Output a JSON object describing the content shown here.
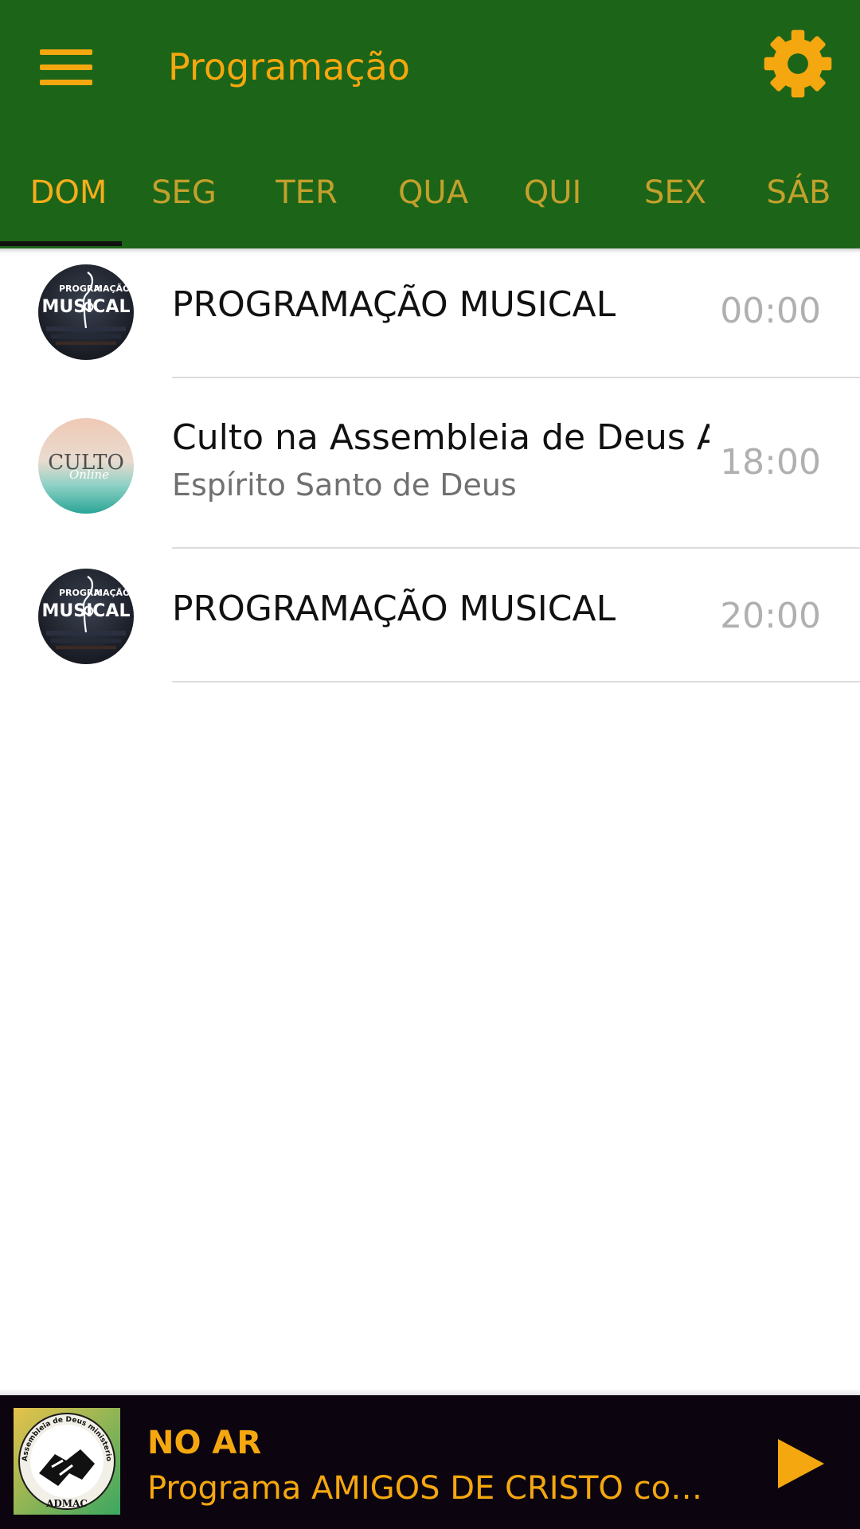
{
  "app": {
    "title": "Programação",
    "menu_icon": "hamburger-menu-icon",
    "settings_icon": "gear-icon",
    "colors": {
      "appbar": "#1c6418",
      "accent": "#f5a70f",
      "tab_inactive": "#c3a02c",
      "player_bg": "#0c0510"
    }
  },
  "tabs": [
    {
      "label": "DOM",
      "active": true
    },
    {
      "label": "SEG",
      "active": false
    },
    {
      "label": "TER",
      "active": false
    },
    {
      "label": "QUA",
      "active": false
    },
    {
      "label": "QUI",
      "active": false
    },
    {
      "label": "SEX",
      "active": false
    },
    {
      "label": "SÁB",
      "active": false
    }
  ],
  "schedule": [
    {
      "title": "PROGRAMAÇÃO MUSICAL",
      "subtitle": "",
      "time": "00:00",
      "thumb_lines": [
        "PROGRA",
        "MAÇÃO",
        "MUSICAL"
      ]
    },
    {
      "title": "Culto na Assembleia de Deus Amigos de Cristo",
      "subtitle": "Espírito Santo de Deus",
      "time": "18:00",
      "thumb_lines": [
        "CULTO",
        "Online"
      ]
    },
    {
      "title": "PROGRAMAÇÃO MUSICAL",
      "subtitle": "",
      "time": "20:00",
      "thumb_lines": [
        "PROGRA",
        "MAÇÃO",
        "MUSICAL"
      ]
    }
  ],
  "player": {
    "status": "NO AR",
    "now_playing": "Programa AMIGOS DE CRISTO com...",
    "logo_text": "ADMAC",
    "logo_ring": "Assembleia de Deus ministerio Amigos de Cristo",
    "play_icon": "play-icon"
  }
}
